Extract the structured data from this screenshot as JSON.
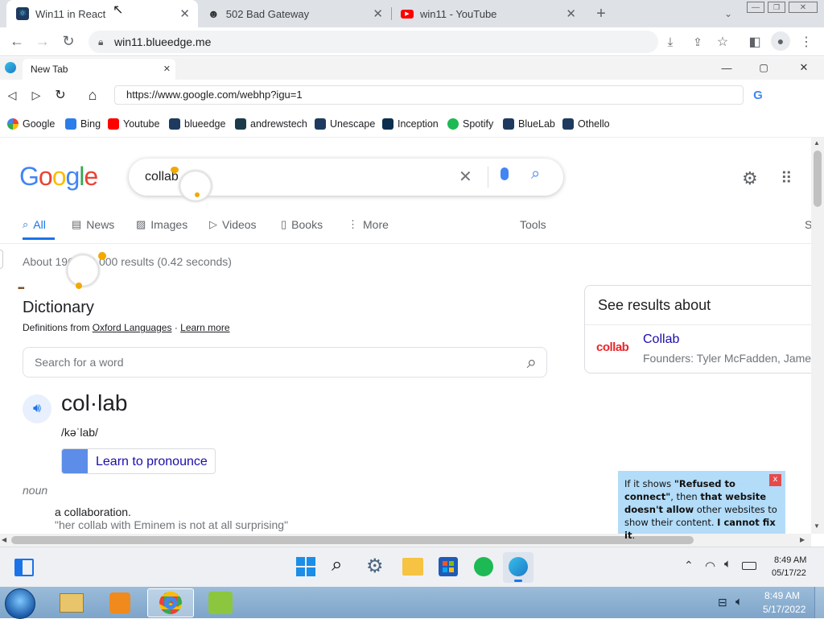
{
  "outer_browser": {
    "tabs": [
      {
        "title": "Win11 in React",
        "icon": "react-icon"
      },
      {
        "title": "502 Bad Gateway",
        "icon": "github-icon"
      },
      {
        "title": "win11 - YouTube",
        "icon": "youtube-icon"
      }
    ],
    "url": "win11.blueedge.me"
  },
  "inner_browser": {
    "tab_title": "New Tab",
    "url": "https://www.google.com/webhp?igu=1",
    "bookmarks": [
      "Google",
      "Bing",
      "Youtube",
      "blueedge",
      "andrewstech",
      "Unescape",
      "Inception",
      "Spotify",
      "BlueLab",
      "Othello"
    ]
  },
  "google": {
    "logo": "Google",
    "query": "collab",
    "tabs": [
      "All",
      "News",
      "Images",
      "Videos",
      "Books",
      "More"
    ],
    "tools": "Tools",
    "right_clip": "S",
    "stats": "About 196,000,000 results (0.42 seconds)",
    "dictionary": {
      "heading": "Dictionary",
      "definitions_from": "Definitions from",
      "source": "Oxford Languages",
      "separator": "·",
      "learn_more": "Learn more",
      "search_placeholder": "Search for a word",
      "word": "col·lab",
      "phonetic": "/kəˈlab/",
      "pronounce": "Learn to pronounce",
      "pos": "noun",
      "definition": "a collaboration.",
      "example": "\"her collab with Eminem is not at all surprising\""
    },
    "side": {
      "heading": "See results about",
      "title": "Collab",
      "subtitle": "Founders: Tyler McFadden, James",
      "logo_text": "collab"
    }
  },
  "tooltip": {
    "text1": "If it shows ",
    "bold1": "\"Refused to connect\"",
    "text2": ", then ",
    "bold2": "that website doesn't allow",
    "text3": " other websites to show their content. ",
    "bold3": "I cannot fix it",
    "text4": ".",
    "close": "x"
  },
  "win11_taskbar": {
    "time": "8:49 AM",
    "date": "05/17/22"
  },
  "win7_taskbar": {
    "time": "8:49 AM",
    "date": "5/17/2022"
  }
}
